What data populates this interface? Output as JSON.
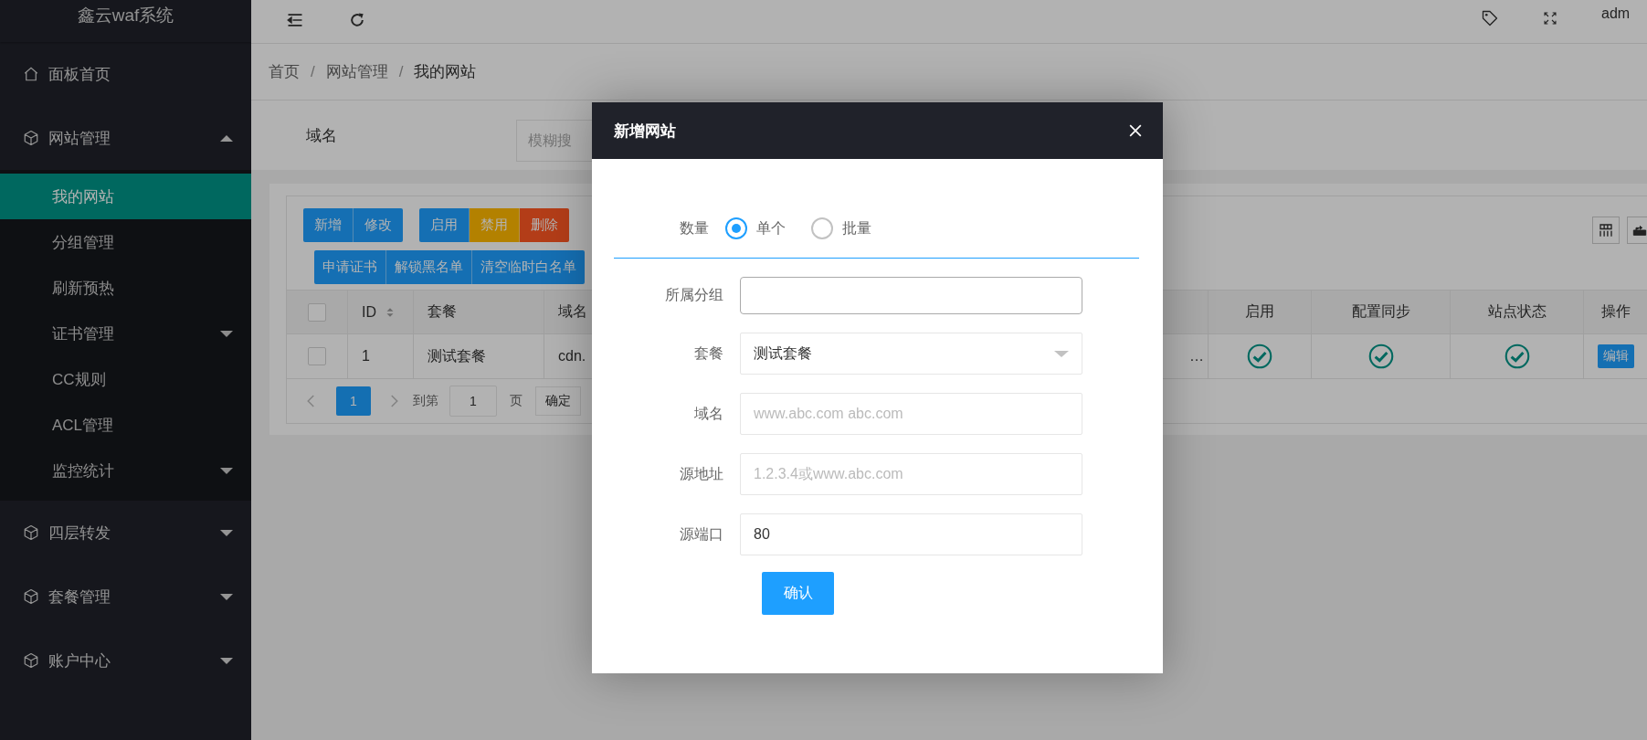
{
  "sidebar": {
    "logo": "鑫云waf系统",
    "items": [
      {
        "label": "面板首页",
        "kind": "link"
      },
      {
        "label": "网站管理",
        "kind": "group",
        "expanded": true,
        "children": [
          {
            "label": "我的网站",
            "kind": "link",
            "selected": true
          },
          {
            "label": "分组管理",
            "kind": "link",
            "selected": false
          },
          {
            "label": "刷新预热",
            "kind": "link",
            "selected": false
          },
          {
            "label": "证书管理",
            "kind": "group",
            "expanded": false,
            "selected": false
          },
          {
            "label": "CC规则",
            "kind": "link",
            "selected": false
          },
          {
            "label": "ACL管理",
            "kind": "link",
            "selected": false
          },
          {
            "label": "监控统计",
            "kind": "group",
            "expanded": false,
            "selected": false
          }
        ]
      },
      {
        "label": "四层转发",
        "kind": "group",
        "expanded": false
      },
      {
        "label": "套餐管理",
        "kind": "group",
        "expanded": false
      },
      {
        "label": "账户中心",
        "kind": "group",
        "expanded": false
      }
    ]
  },
  "topbar": {
    "user": "adm"
  },
  "breadcrumb": {
    "items": [
      "首页",
      "网站管理",
      "我的网站"
    ],
    "separator": "/"
  },
  "search": {
    "label": "域名",
    "placeholder": "模糊搜"
  },
  "toolbar": {
    "groups": [
      {
        "buttons": [
          {
            "label": "新增",
            "color": "#156fb3"
          },
          {
            "label": "修改",
            "color": "#156fb3"
          }
        ]
      },
      {
        "buttons": [
          {
            "label": "启用",
            "color": "#156fb3"
          },
          {
            "label": "禁用",
            "color": "#b38100"
          },
          {
            "label": "删除",
            "color": "#b33d18"
          }
        ]
      },
      {
        "buttons": [
          {
            "label": "申请证书",
            "color": "#156fb3"
          },
          {
            "label": "解锁黑名单",
            "color": "#156fb3"
          },
          {
            "label": "清空临时白名单",
            "color": "#156fb3"
          }
        ]
      }
    ]
  },
  "table": {
    "all_selected": false,
    "columns": [
      {
        "label": "ID",
        "sortable": true
      },
      {
        "label": "套餐"
      },
      {
        "label": "域名"
      },
      {
        "label": "启用"
      },
      {
        "label": "配置同步"
      },
      {
        "label": "站点状态"
      },
      {
        "label": "操作"
      }
    ],
    "rows": [
      {
        "selected": false,
        "id": "1",
        "package": "测试套餐",
        "domain": "cdn.",
        "column_5": "…",
        "enabled": true,
        "config_synced": true,
        "site_status": true,
        "action": "编辑"
      }
    ]
  },
  "pagination": {
    "pages": [
      {
        "label": "1",
        "selected": true
      }
    ],
    "goto_label": "到第",
    "goto_value": "1",
    "page_suffix": "页",
    "confirm": "确定"
  },
  "modal": {
    "title": "新增网站",
    "quantity": {
      "label": "数量",
      "options": [
        {
          "label": "单个",
          "selected": true
        },
        {
          "label": "批量",
          "selected": false
        }
      ]
    },
    "fields": [
      {
        "label": "所属分组",
        "kind": "text"
      },
      {
        "label": "套餐",
        "kind": "select",
        "value": "测试套餐"
      },
      {
        "label": "域名",
        "kind": "text",
        "placeholder": "www.abc.com abc.com"
      },
      {
        "label": "源地址",
        "kind": "text",
        "placeholder": "1.2.3.4或www.abc.com"
      },
      {
        "label": "源端口",
        "kind": "text",
        "value": "80"
      }
    ],
    "submit": "确认"
  }
}
